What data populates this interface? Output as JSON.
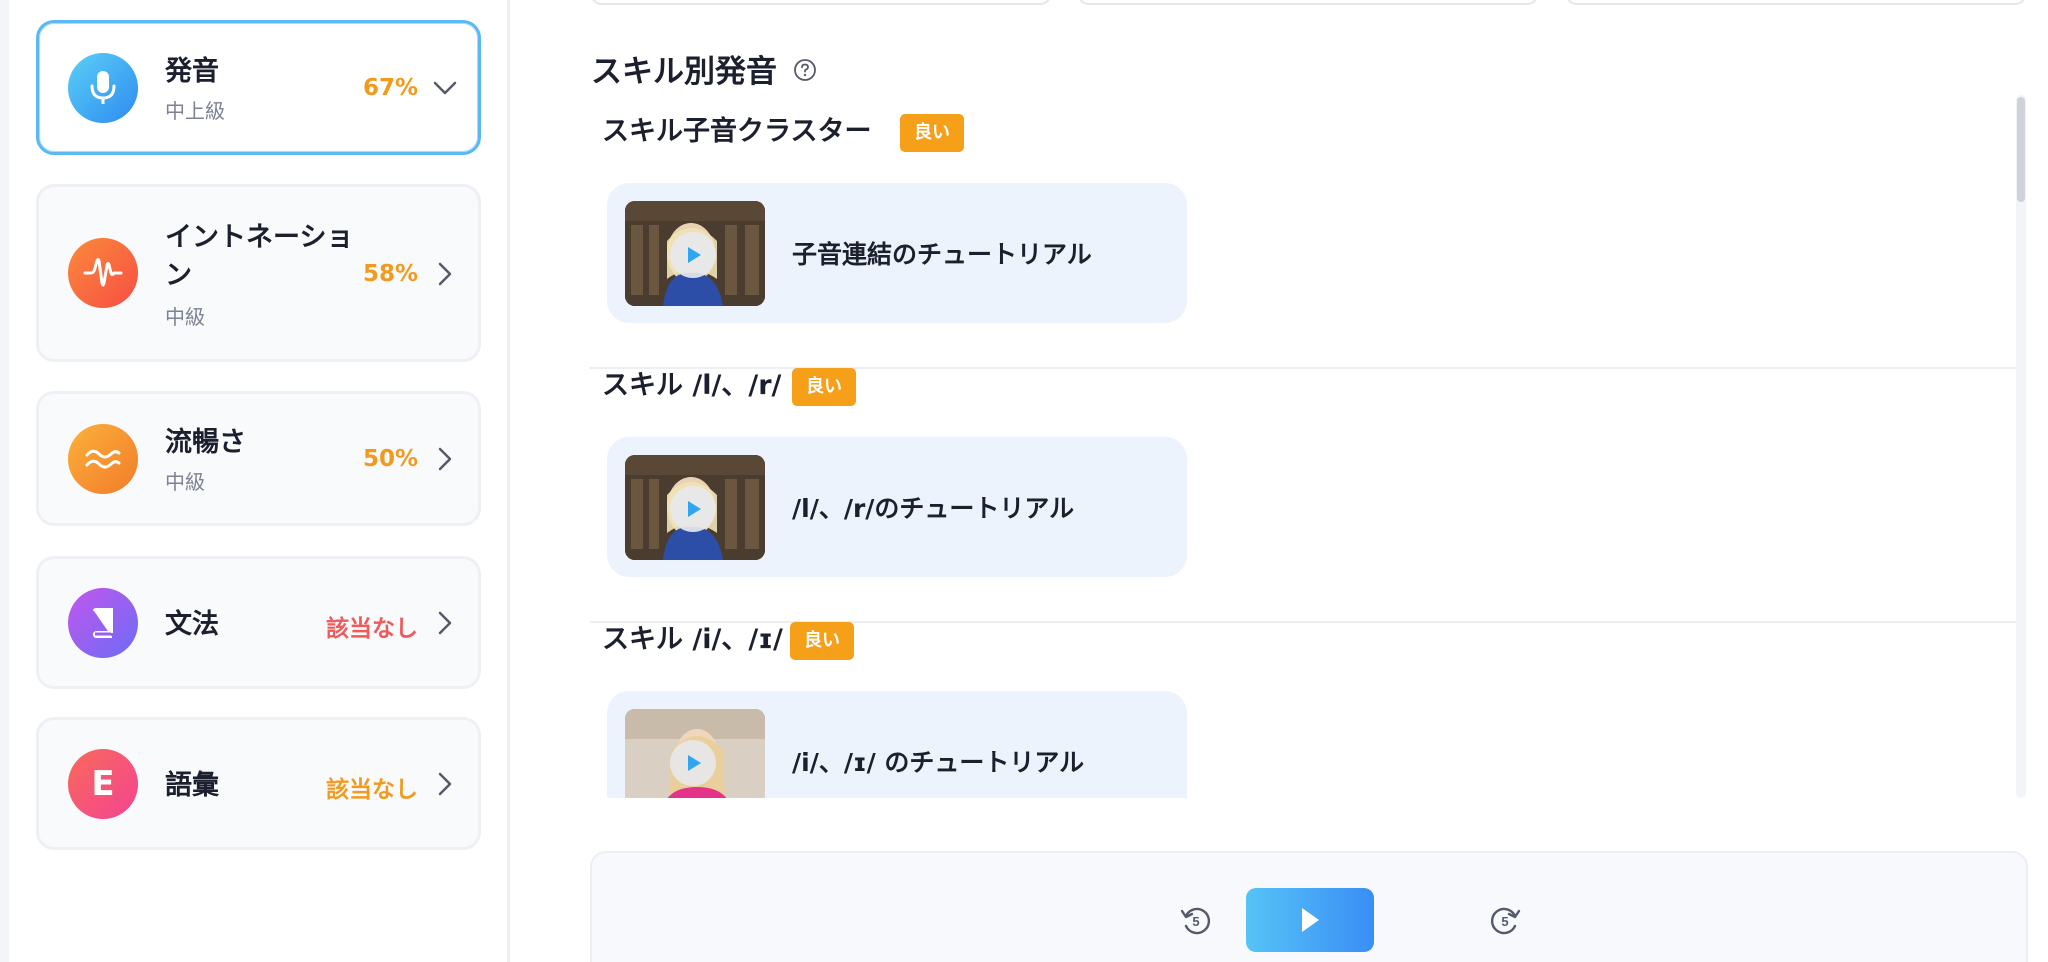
{
  "sidebar": {
    "skills": [
      {
        "title": "発音",
        "level": "中上級",
        "score": "67%",
        "icon": "microphone-icon",
        "icon_color": "#3aa2f3",
        "score_color": "#f29a1f",
        "expanded": true
      },
      {
        "title_line1": "イントネーショ",
        "title_line2": "ン",
        "level": "中級",
        "score": "58%",
        "icon": "waveform-icon",
        "icon_color": "#f8663a",
        "score_color": "#f29a1f"
      },
      {
        "title": "流暢さ",
        "level": "中級",
        "score": "50%",
        "icon": "wave-lines-icon",
        "icon_color": "#f5902d",
        "score_color": "#f29a1f"
      },
      {
        "title": "文法",
        "score": "該当なし",
        "icon": "book-icon",
        "icon_color": "#9b5cf0",
        "score_color": "#ef5a5a"
      },
      {
        "title": "語彙",
        "score": "該当なし",
        "icon": "letter-e-icon",
        "icon_letter": "E",
        "icon_color": "#f8507a",
        "score_color": "#f29a1f"
      }
    ]
  },
  "main": {
    "section_title": "スキル別発音",
    "skill_sections": [
      {
        "heading": "スキル子音クラスター",
        "badge": "良い",
        "tutorial": "子音連結のチュートリアル"
      },
      {
        "heading": "スキル /l/、/r/",
        "badge": "良い",
        "tutorial": "/l/、/r/のチュートリアル"
      },
      {
        "heading": "スキル /i/、/ɪ/",
        "badge": "良い",
        "tutorial": "/i/、/ɪ/ のチュートリアル"
      }
    ]
  },
  "player": {
    "rewind_seconds": "5",
    "forward_seconds": "5"
  },
  "colors": {
    "accent_blue": "#3a8ef5",
    "badge_orange": "#f6a01a",
    "card_bg": "#edf3fd"
  }
}
